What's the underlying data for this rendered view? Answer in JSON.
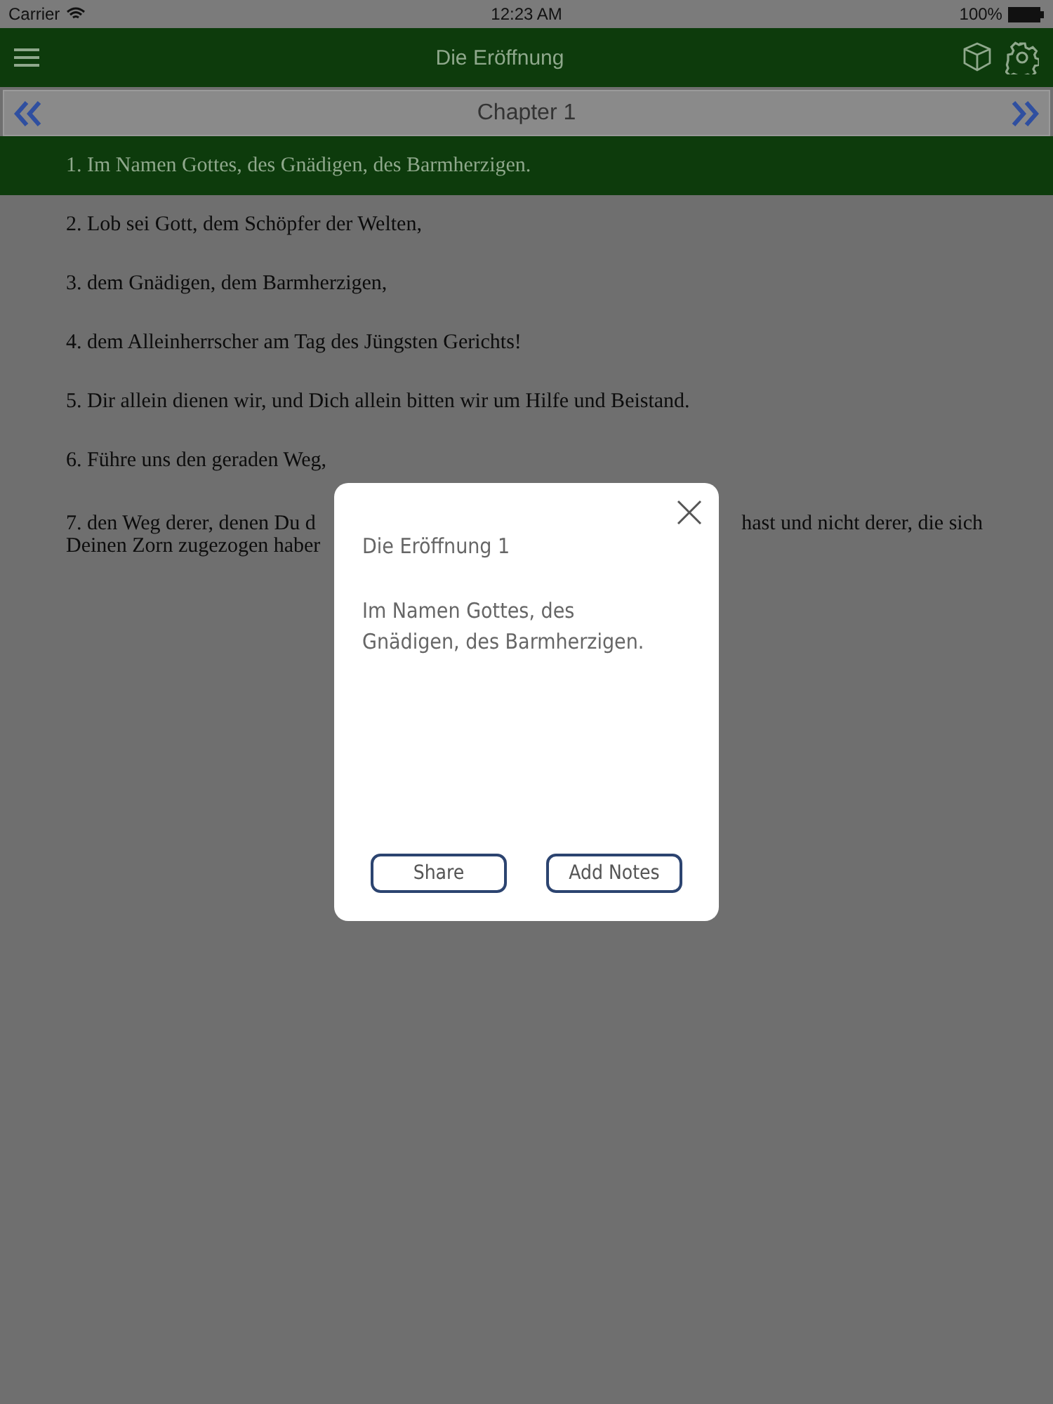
{
  "status_bar": {
    "carrier": "Carrier",
    "time": "12:23 AM",
    "battery": "100%"
  },
  "nav_bar": {
    "title": "Die Eröffnung"
  },
  "chapter_bar": {
    "title": "Chapter 1"
  },
  "verses": [
    {
      "text": "1. Im Namen Gottes, des Gnädigen, des Barmherzigen.",
      "selected": true
    },
    {
      "text": "2. Lob sei Gott, dem Schöpfer der Welten,",
      "selected": false
    },
    {
      "text": "3. dem Gnädigen, dem Barmherzigen,",
      "selected": false
    },
    {
      "text": "4. dem Alleinherrscher am Tag des Jüngsten Gerichts!",
      "selected": false
    },
    {
      "text": "5. Dir allein dienen wir, und Dich allein bitten wir um Hilfe und Beistand.",
      "selected": false
    },
    {
      "text": "6. Führe uns den geraden Weg,",
      "selected": false
    }
  ],
  "covered_verse": {
    "line_1_left": "7. den Weg derer, denen Du d",
    "line_1_right": "hast und nicht derer, die sich",
    "line_2": "Deinen Zorn zugezogen haber"
  },
  "dialog": {
    "title": "Die Eröffnung 1",
    "body": "Im Namen Gottes, des Gnädigen, des Barmherzigen.",
    "buttons": [
      "Share",
      "Add Notes"
    ]
  }
}
